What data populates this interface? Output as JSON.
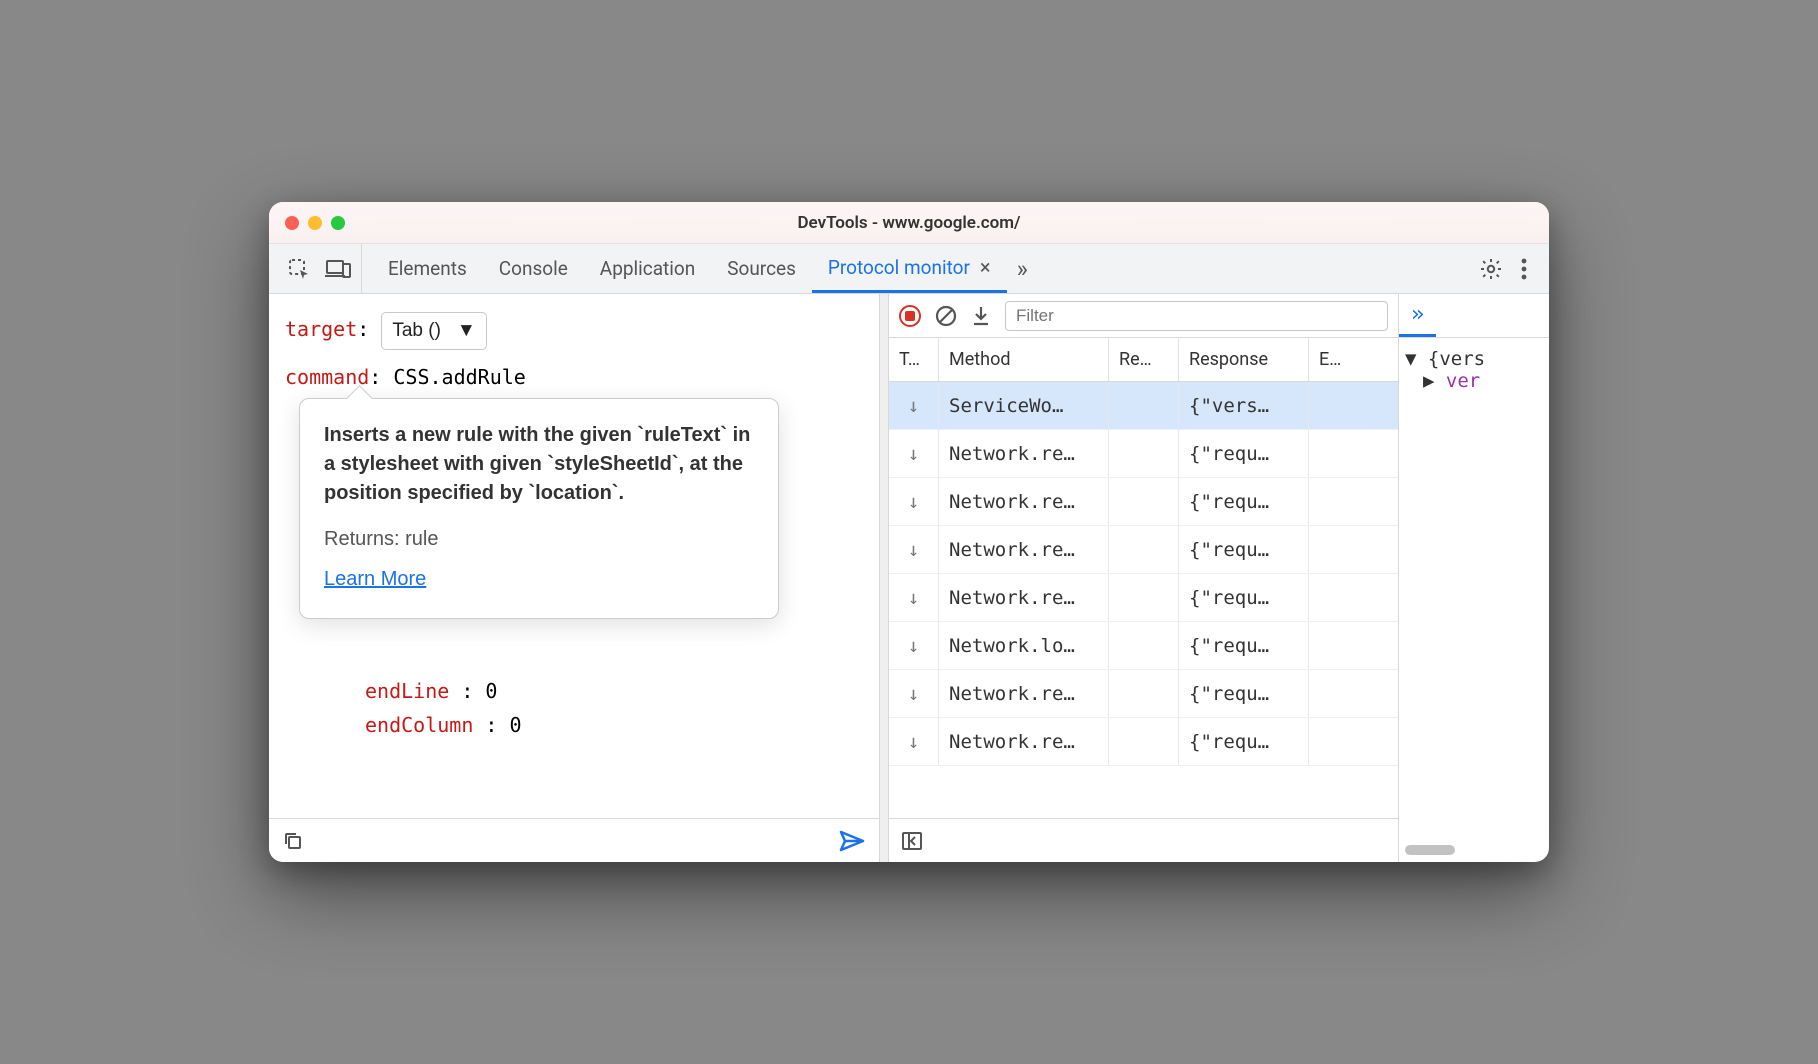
{
  "window": {
    "title": "DevTools - www.google.com/"
  },
  "tabs": {
    "items": [
      "Elements",
      "Console",
      "Application",
      "Sources",
      "Protocol monitor"
    ],
    "activeIndex": 4
  },
  "left": {
    "target_label": "target",
    "target_value": "Tab ()",
    "command_label": "command",
    "command_value": "CSS.addRule",
    "tooltip": {
      "description": "Inserts a new rule with the given `ruleText` in a stylesheet with given `styleSheetId`, at the position specified by `location`.",
      "returns": "Returns: rule",
      "learn_more": "Learn More"
    },
    "params": [
      {
        "key": "endLine",
        "value": "0"
      },
      {
        "key": "endColumn",
        "value": "0"
      }
    ]
  },
  "mid": {
    "filter_placeholder": "Filter",
    "columns": {
      "t": "T…",
      "method": "Method",
      "re": "Re…",
      "response": "Response",
      "e": "E…"
    },
    "rows": [
      {
        "dir": "↓",
        "method": "ServiceWo…",
        "re": "",
        "response": "{\"vers…",
        "e": "",
        "selected": true
      },
      {
        "dir": "↓",
        "method": "Network.re…",
        "re": "",
        "response": "{\"requ…",
        "e": ""
      },
      {
        "dir": "↓",
        "method": "Network.re…",
        "re": "",
        "response": "{\"requ…",
        "e": ""
      },
      {
        "dir": "↓",
        "method": "Network.re…",
        "re": "",
        "response": "{\"requ…",
        "e": ""
      },
      {
        "dir": "↓",
        "method": "Network.re…",
        "re": "",
        "response": "{\"requ…",
        "e": ""
      },
      {
        "dir": "↓",
        "method": "Network.lo…",
        "re": "",
        "response": "{\"requ…",
        "e": ""
      },
      {
        "dir": "↓",
        "method": "Network.re…",
        "re": "",
        "response": "{\"requ…",
        "e": ""
      },
      {
        "dir": "↓",
        "method": "Network.re…",
        "re": "",
        "response": "{\"requ…",
        "e": ""
      }
    ]
  },
  "right": {
    "tree_root": "{vers",
    "tree_child": "ver"
  }
}
